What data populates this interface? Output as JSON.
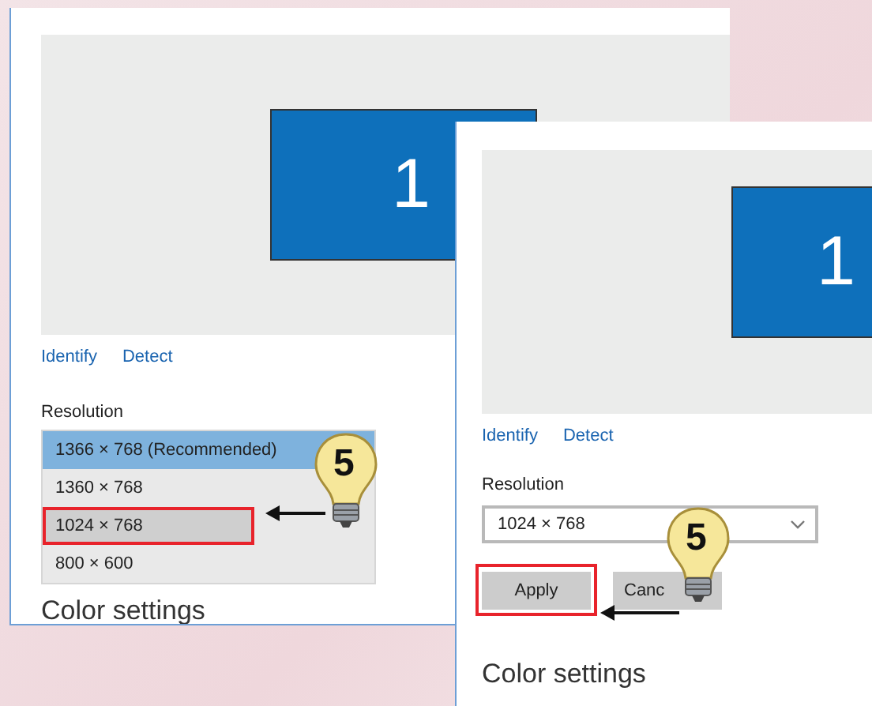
{
  "windows": [
    {
      "preview": {
        "monitor_label": "1"
      },
      "links": [
        "Identify",
        "Detect"
      ],
      "resolution_label": "Resolution",
      "resolution_list": [
        {
          "label": "1366 × 768 (Recommended)",
          "selected": true,
          "hovered": false,
          "highlighted": false
        },
        {
          "label": "1360 × 768",
          "selected": false,
          "hovered": false,
          "highlighted": false
        },
        {
          "label": "1024 × 768",
          "selected": false,
          "hovered": true,
          "highlighted": true
        },
        {
          "label": "800 × 600",
          "selected": false,
          "hovered": false,
          "highlighted": false
        }
      ],
      "section_heading": "Color settings"
    },
    {
      "preview": {
        "monitor_label": "1"
      },
      "links": [
        "Identify",
        "Detect"
      ],
      "resolution_label": "Resolution",
      "resolution_dropdown": {
        "value": "1024 × 768"
      },
      "buttons": [
        {
          "label": "Apply",
          "highlighted": true
        },
        {
          "label": "Canc",
          "highlighted": false
        }
      ],
      "section_heading": "Color settings"
    }
  ],
  "callouts": [
    {
      "number": "5"
    },
    {
      "number": "5"
    }
  ]
}
